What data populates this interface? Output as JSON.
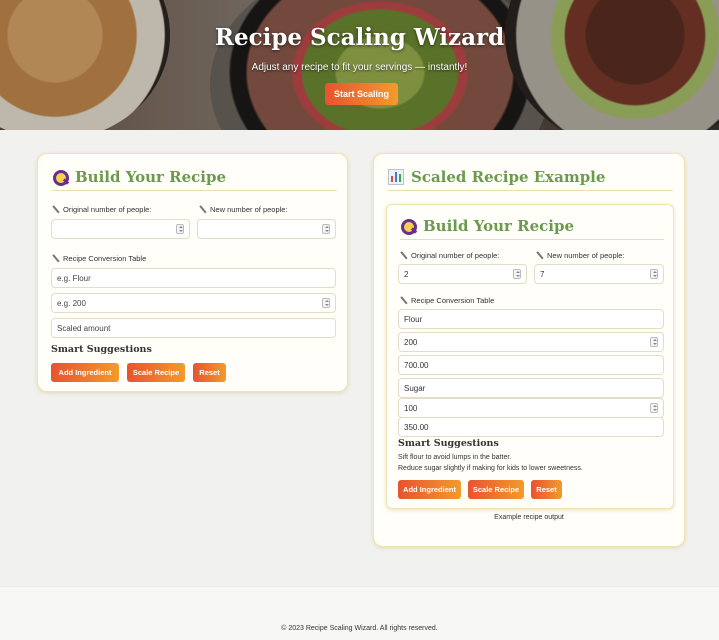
{
  "hero": {
    "title": "Recipe Scaling Wizard",
    "subtitle": "Adjust any recipe to fit your servings — instantly!",
    "cta_label": "Start Scaling"
  },
  "builder": {
    "title": "Build Your Recipe",
    "original_label": "Original number of people:",
    "new_label": "New number of people:",
    "table_label": "Recipe Conversion Table",
    "ingredient_placeholder": "e.g. Flour",
    "amount_placeholder": "e.g. 200",
    "scaled_placeholder": "Scaled amount",
    "smart_title": "Smart Suggestions",
    "add_label": "Add Ingredient",
    "scale_label": "Scale Recipe",
    "reset_label": "Reset"
  },
  "example": {
    "title": "Scaled Recipe Example",
    "inner_title": "Build Your Recipe",
    "original_label": "Original number of people:",
    "new_label": "New number of people:",
    "original_value": "2",
    "new_value": "7",
    "table_label": "Recipe Conversion Table",
    "rows": [
      {
        "ingredient": "Flour",
        "amount": "200",
        "scaled": "700.00"
      },
      {
        "ingredient": "Sugar",
        "amount": "100",
        "scaled": "350.00"
      }
    ],
    "smart_title": "Smart Suggestions",
    "tips": [
      "Sift flour to avoid lumps in the batter.",
      "Reduce sugar slightly if making for kids to lower sweetness."
    ],
    "add_label": "Add Ingredient",
    "scale_label": "Scale Recipe",
    "reset_label": "Reset",
    "caption": "Example recipe output"
  },
  "footer": {
    "text": "© 2023 Recipe Scaling Wizard. All rights reserved."
  },
  "colors": {
    "accent_green": "#6b9a4f",
    "button_start": "#e8532f",
    "button_end": "#f39a2c",
    "card_border": "#f1e3b4"
  },
  "icons": {
    "builder": "magnifier-icon",
    "example": "bar-chart-icon",
    "label": "pin-icon"
  }
}
